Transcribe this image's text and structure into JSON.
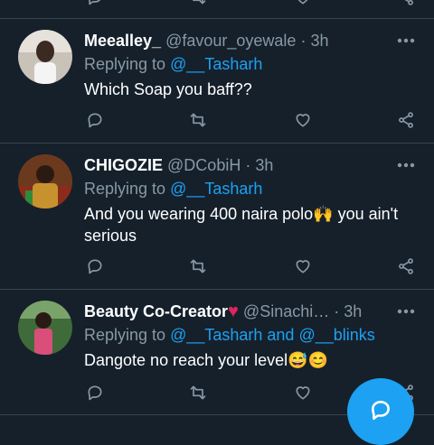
{
  "tweets": [
    {
      "display_name": "Meealley_",
      "handle": "@favour_oyewale",
      "separator": "·",
      "time": "3h",
      "replying_prefix": "Replying to",
      "replying_to": "@__Tasharh",
      "text": "Which Soap you baff??"
    },
    {
      "display_name": "CHIGOZIE",
      "handle": "@DCobiH",
      "separator": "·",
      "time": "3h",
      "replying_prefix": "Replying to",
      "replying_to": "@__Tasharh",
      "text_line1": "And you wearing 400 naira polo",
      "emoji1": "🙌",
      "text_line1_end": " you ain't",
      "text_line2": "serious"
    },
    {
      "display_name": "Beauty Co-Creator",
      "name_emoji": "♥",
      "handle": "@Sinachi…",
      "separator": "·",
      "time": "3h",
      "replying_prefix": "Replying to",
      "replying_to": "@__Tasharh and @__blinks",
      "text": "Dangote no reach your level",
      "emoji": "😅😊"
    }
  ],
  "icons": {
    "reply": "reply-icon",
    "retweet": "retweet-icon",
    "like": "heart-icon",
    "share": "share-icon",
    "more": "more-icon",
    "compose": "compose-icon"
  },
  "colors": {
    "background": "#15202b",
    "divider": "#38444d",
    "secondary_text": "#8899a6",
    "link": "#1da1f2",
    "heart": "#e0245e"
  }
}
